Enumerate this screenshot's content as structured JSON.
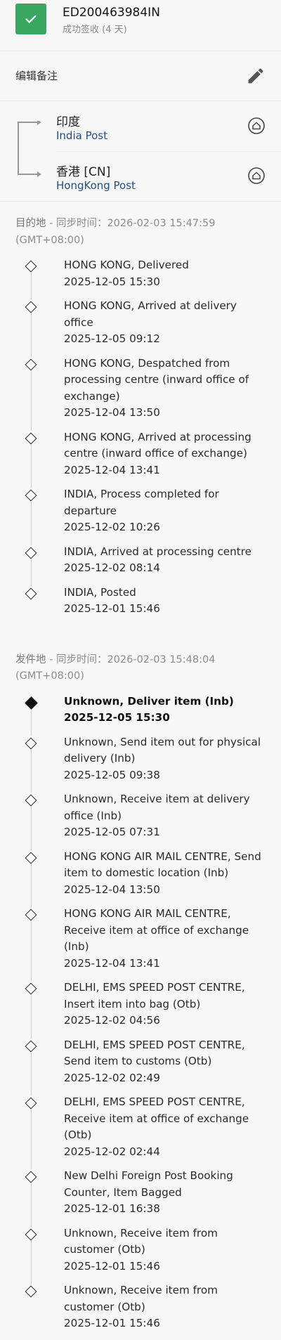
{
  "header": {
    "tracking_number": "ED200463984IN",
    "status": "成功签收 (4 天)",
    "status_color": "#3aa760"
  },
  "remark": {
    "label": "编辑备注"
  },
  "route": {
    "origin": {
      "name": "印度",
      "carrier": "India Post"
    },
    "destination": {
      "name": "香港 [CN]",
      "carrier": "HongKong Post"
    }
  },
  "destination_section": {
    "label": "目的地",
    "sync": " - 同步时间：2026-02-03 15:47:59 (GMT+08:00)",
    "events": [
      {
        "desc": "HONG KONG, Delivered",
        "time": "2025-12-05 15:30"
      },
      {
        "desc": "HONG KONG, Arrived at delivery office",
        "time": "2025-12-05 09:12"
      },
      {
        "desc": "HONG KONG, Despatched from processing centre (inward office of exchange)",
        "time": "2025-12-04 13:50"
      },
      {
        "desc": "HONG KONG, Arrived at processing centre (inward office of exchange)",
        "time": "2025-12-04 13:41"
      },
      {
        "desc": "INDIA, Process completed for departure",
        "time": "2025-12-02 10:26"
      },
      {
        "desc": "INDIA, Arrived at processing centre",
        "time": "2025-12-02 08:14"
      },
      {
        "desc": "INDIA, Posted",
        "time": "2025-12-01 15:46"
      }
    ]
  },
  "origin_section": {
    "label": "发件地",
    "sync": " - 同步时间：2026-02-03 15:48:04 (GMT+08:00)",
    "events": [
      {
        "desc": "Unknown, Deliver item (Inb)",
        "time": "2025-12-05 15:30",
        "highlight": true
      },
      {
        "desc": "Unknown, Send item out for physical delivery (Inb)",
        "time": "2025-12-05 09:38"
      },
      {
        "desc": "Unknown, Receive item at delivery office (Inb)",
        "time": "2025-12-05 07:31"
      },
      {
        "desc": "HONG KONG AIR MAIL CENTRE, Send item to domestic location (Inb)",
        "time": "2025-12-04 13:50"
      },
      {
        "desc": "HONG KONG AIR MAIL CENTRE, Receive item at office of exchange (Inb)",
        "time": "2025-12-04 13:41"
      },
      {
        "desc": "DELHI, EMS SPEED POST CENTRE, Insert item into bag (Otb)",
        "time": "2025-12-02 04:56"
      },
      {
        "desc": "DELHI, EMS SPEED POST CENTRE, Send item to customs (Otb)",
        "time": "2025-12-02 02:49"
      },
      {
        "desc": "DELHI, EMS SPEED POST CENTRE, Receive item at office of exchange (Otb)",
        "time": "2025-12-02 02:44"
      },
      {
        "desc": "New Delhi Foreign Post Booking Counter, Item Bagged",
        "time": "2025-12-01 16:38"
      },
      {
        "desc": "Unknown, Receive item from customer (Otb)",
        "time": "2025-12-01 15:46"
      },
      {
        "desc": "Unknown, Receive item from customer (Otb)",
        "time": "2025-12-01 15:46"
      }
    ]
  }
}
